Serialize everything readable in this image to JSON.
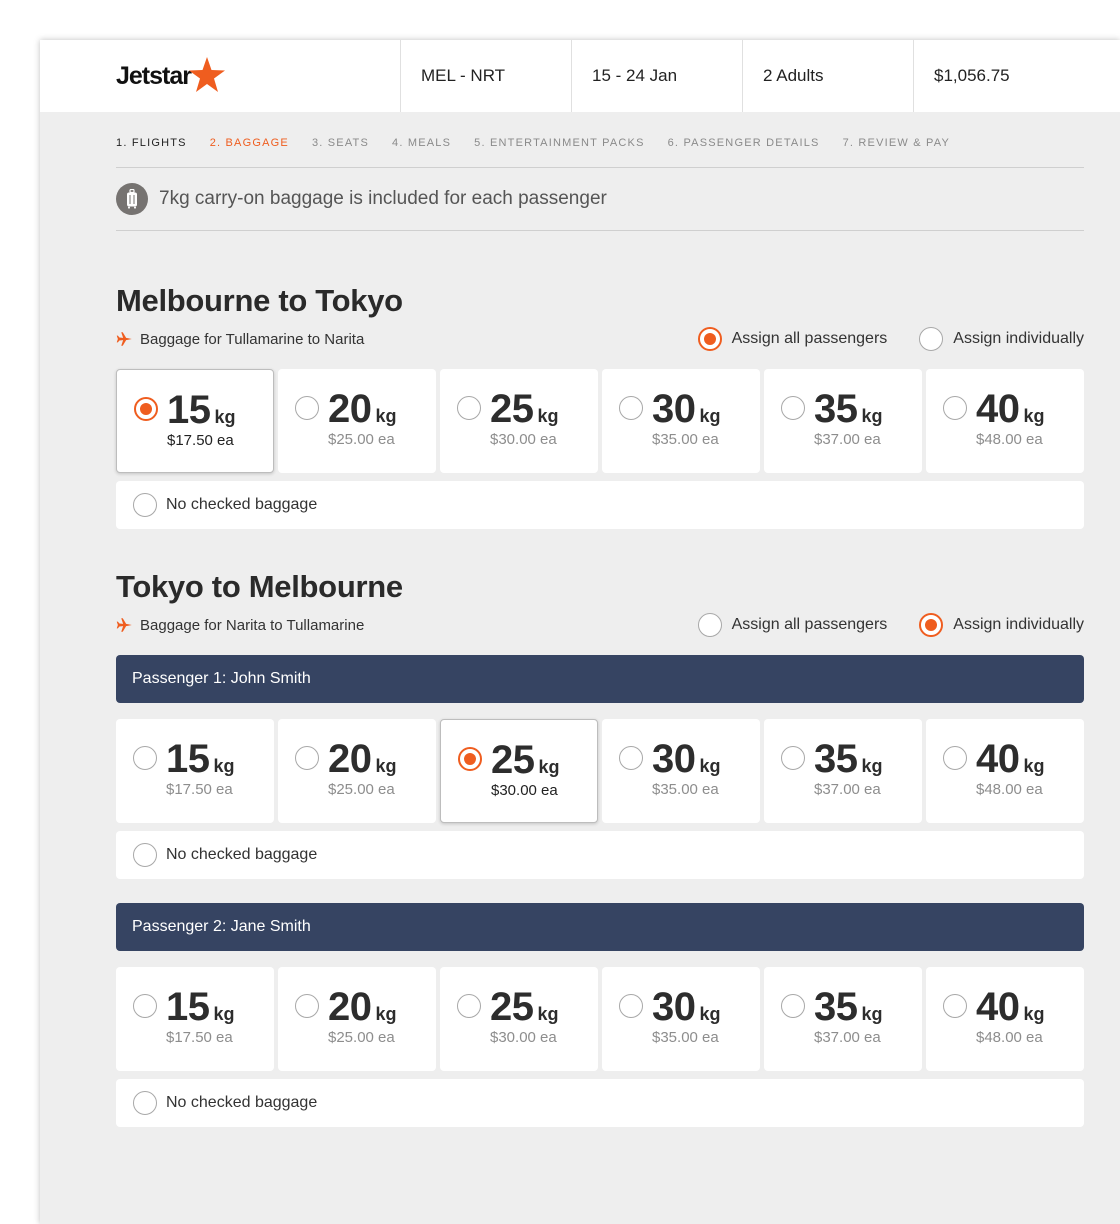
{
  "header": {
    "logo_text": "Jetstar",
    "route": "MEL - NRT",
    "dates": "15 - 24 Jan",
    "passengers": "2 Adults",
    "total": "$1,056.75"
  },
  "steps": [
    {
      "label": "1. FLIGHTS",
      "state": "done"
    },
    {
      "label": "2. BAGGAGE",
      "state": "active"
    },
    {
      "label": "3. SEATS",
      "state": "todo"
    },
    {
      "label": "4. MEALS",
      "state": "todo"
    },
    {
      "label": "5. ENTERTAINMENT PACKS",
      "state": "todo"
    },
    {
      "label": "6. PASSENGER DETAILS",
      "state": "todo"
    },
    {
      "label": "7. REVIEW & PAY",
      "state": "todo"
    }
  ],
  "info": {
    "icon": "luggage-icon",
    "text": "7kg carry-on baggage is included for each passenger"
  },
  "baggage_options": [
    {
      "weight": "15",
      "unit": "kg",
      "price": "$17.50 ea"
    },
    {
      "weight": "20",
      "unit": "kg",
      "price": "$25.00 ea"
    },
    {
      "weight": "25",
      "unit": "kg",
      "price": "$30.00 ea"
    },
    {
      "weight": "30",
      "unit": "kg",
      "price": "$35.00 ea"
    },
    {
      "weight": "35",
      "unit": "kg",
      "price": "$37.00 ea"
    },
    {
      "weight": "40",
      "unit": "kg",
      "price": "$48.00 ea"
    }
  ],
  "no_bag_label": "No checked baggage",
  "assign_all_label": "Assign all passengers",
  "assign_individually_label": "Assign individually",
  "outbound": {
    "title": "Melbourne to Tokyo",
    "subtitle": "Baggage for Tullamarine to Narita",
    "assign_mode": "all",
    "selected_weight": "15"
  },
  "return": {
    "title": "Tokyo to Melbourne",
    "subtitle": "Baggage for Narita to Tullamarine",
    "assign_mode": "individual",
    "passengers": [
      {
        "label": "Passenger 1: John Smith",
        "selected_weight": "25"
      },
      {
        "label": "Passenger 2: Jane Smith",
        "selected_weight": null
      }
    ]
  },
  "colors": {
    "accent": "#ef5d1f",
    "passenger_bar": "#364462",
    "background": "#eeeeee"
  }
}
